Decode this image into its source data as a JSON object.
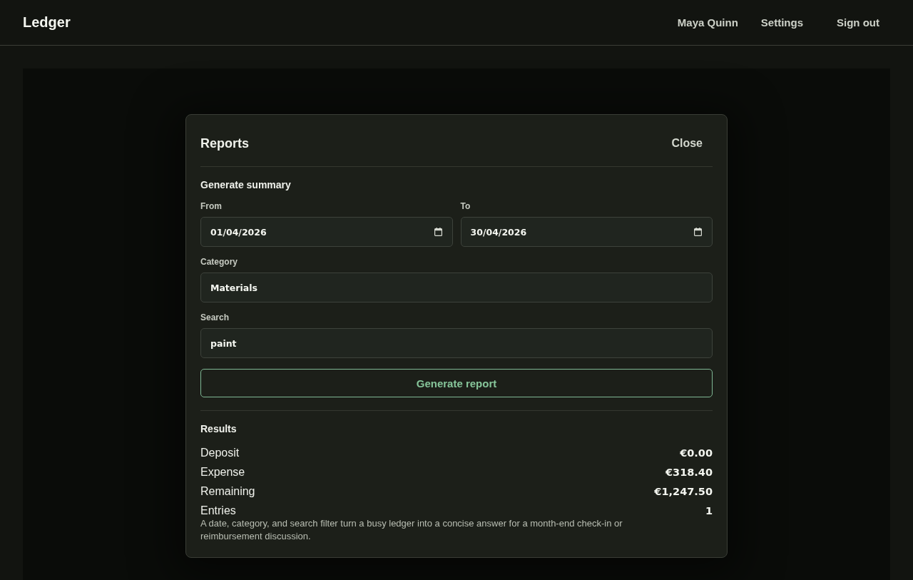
{
  "header": {
    "brand": "Ledger",
    "user_name": "Maya Quinn",
    "actions": [
      {
        "kind": "link",
        "label": "Settings"
      },
      {
        "kind": "button",
        "label": "Sign out"
      }
    ]
  },
  "dialog": {
    "title": "Reports",
    "close_label": "Close",
    "form": {
      "heading": "Generate summary",
      "date_fields": [
        {
          "label": "From",
          "value": "01/04/2026"
        },
        {
          "label": "To",
          "value": "30/04/2026"
        }
      ],
      "text_fields": [
        {
          "label": "Category",
          "value": "Materials"
        },
        {
          "label": "Search",
          "value": "paint"
        }
      ],
      "submit_label": "Generate report"
    },
    "results": {
      "heading": "Results",
      "rows": [
        {
          "label": "Deposit",
          "value": "€0.00"
        },
        {
          "label": "Expense",
          "value": "€318.40"
        },
        {
          "label": "Remaining",
          "value": "€1,247.50"
        },
        {
          "label": "Entries",
          "value": "1"
        }
      ],
      "note": "A date, category, and search filter turn a busy ledger into a concise answer for a month-end check-in or reimbursement discussion."
    }
  }
}
